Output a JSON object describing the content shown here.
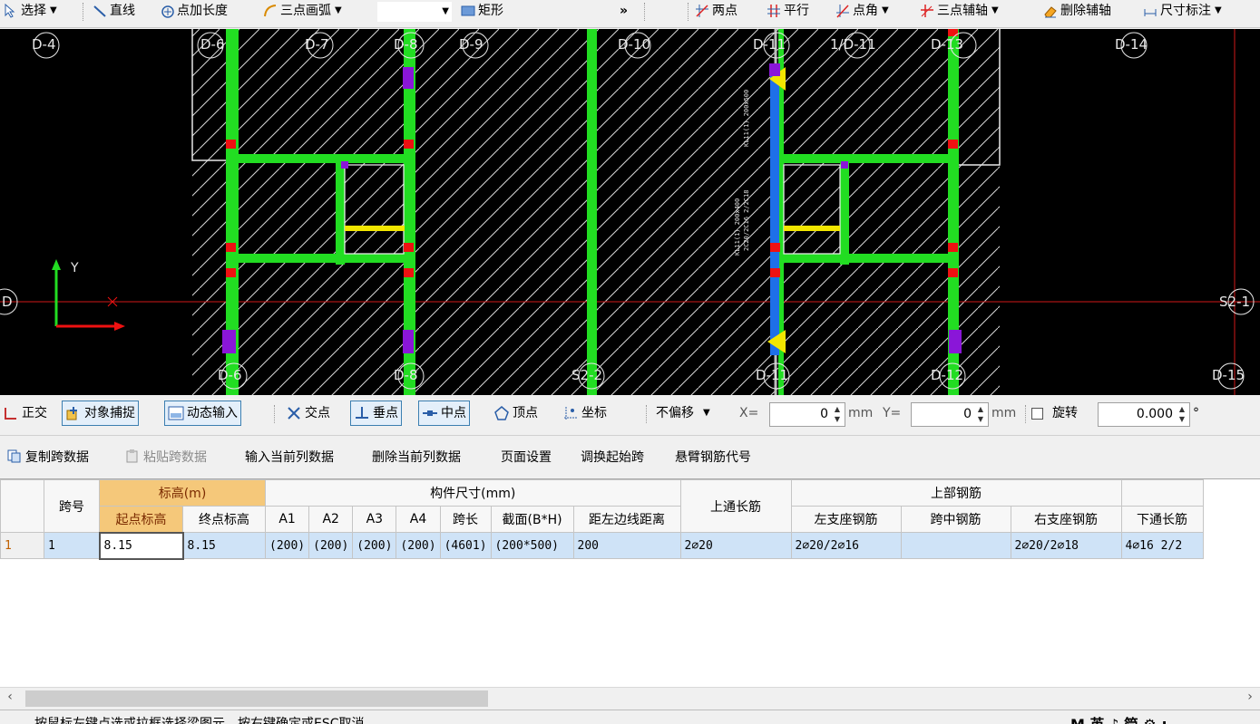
{
  "top_toolbar": {
    "select": "选择",
    "line": "直线",
    "point_length": "点加长度",
    "arc": "三点画弧",
    "rect": "矩形",
    "more": "»",
    "two_points": "两点",
    "parallel": "平行",
    "point_angle": "点角",
    "three_point_axis": "三点辅轴",
    "delete_axis": "删除辅轴",
    "dimension": "尺寸标注"
  },
  "canvas": {
    "axis_labels_top": [
      "D-4",
      "D-6",
      "D-7",
      "D-8",
      "D-9",
      "D-10",
      "D-11",
      "1/D-11",
      "D-13",
      "D-14"
    ],
    "axis_labels_bottom": [
      "D-6",
      "D-8",
      "S2-2",
      "D-11",
      "D-12",
      "D-15"
    ],
    "axis_left": "D",
    "axis_right": "S2-1",
    "ucs_y": "Y",
    "ucs_x": "X",
    "annotation_1": "KL11(1) 200x400",
    "annotation_2": "2C20/2C16 2/2C18",
    "annotation_3": "KL11(1) 200x500"
  },
  "snap_toolbar": {
    "ortho": "正交",
    "object_snap": "对象捕捉",
    "dynamic_input": "动态输入",
    "intersection": "交点",
    "perpendicular": "垂点",
    "midpoint": "中点",
    "vertex": "顶点",
    "coordinate": "坐标",
    "offset_mode": "不偏移",
    "x_label": "X=",
    "x_value": "0",
    "mm1": "mm",
    "y_label": "Y=",
    "y_value": "0",
    "mm2": "mm",
    "rotate": "旋转",
    "rotate_value": "0.000",
    "degree": "°"
  },
  "data_toolbar": {
    "copy_span": "复制跨数据",
    "paste_span": "粘贴跨数据",
    "input_column": "输入当前列数据",
    "delete_column": "删除当前列数据",
    "page_setup": "页面设置",
    "swap_start": "调换起始跨",
    "cantilever_code": "悬臂钢筋代号"
  },
  "table": {
    "h_span_no": "跨号",
    "h_elevation": "标高(m)",
    "h_start_elev": "起点标高",
    "h_end_elev": "终点标高",
    "h_member_size": "构件尺寸(mm)",
    "h_a1": "A1",
    "h_a2": "A2",
    "h_a3": "A3",
    "h_a4": "A4",
    "h_span_len": "跨长",
    "h_section": "截面(B*H)",
    "h_dist_left": "距左边线距离",
    "h_top_through": "上通长筋",
    "h_top_rebar": "上部钢筋",
    "h_left_support": "左支座钢筋",
    "h_mid_span": "跨中钢筋",
    "h_right_support": "右支座钢筋",
    "h_bottom_through": "下通长筋",
    "rows": [
      {
        "row_num": "1",
        "span_no": "1",
        "start_elev": "8.15",
        "end_elev": "8.15",
        "a1": "(200)",
        "a2": "(200)",
        "a3": "(200)",
        "a4": "(200)",
        "span_len": "(4601)",
        "section": "(200*500)",
        "dist_left": "200",
        "top_through": "2⌀20",
        "left_support": "2⌀20/2⌀16",
        "mid_span": "",
        "right_support": "2⌀20/2⌀18",
        "bottom_through": "4⌀16 2/2"
      }
    ]
  },
  "status": {
    "message": "按鼠标左键点选或拉框选择梁图元，按右键确定或ESC取消",
    "right": "M 英 ♪ 简 ⚙ :"
  }
}
